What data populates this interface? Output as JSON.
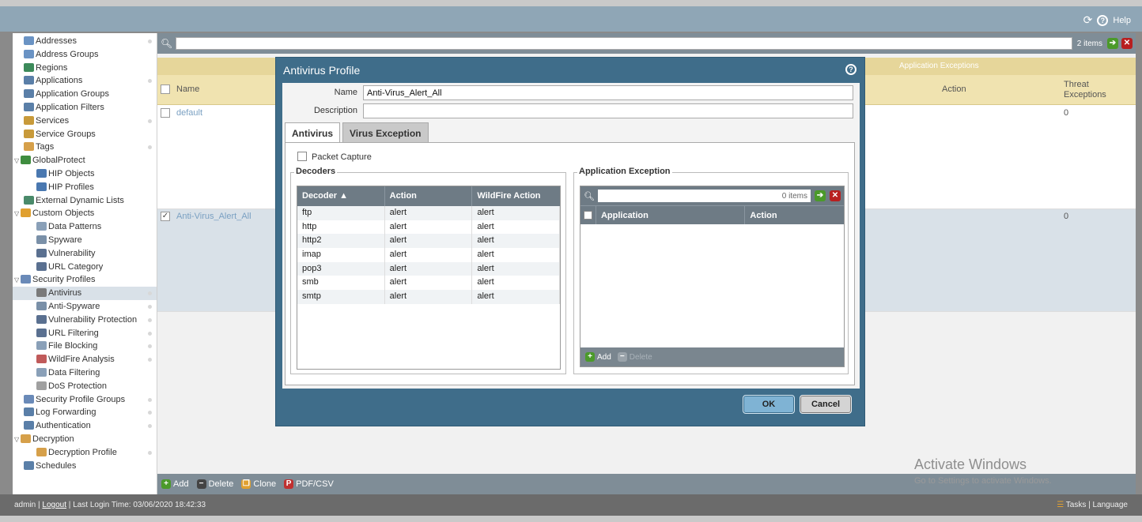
{
  "header": {
    "help_label": "Help"
  },
  "sidebar": {
    "items": [
      {
        "label": "Addresses",
        "level": 1,
        "twisty": "",
        "color": "#6a93c4",
        "dot": true
      },
      {
        "label": "Address Groups",
        "level": 1,
        "twisty": "",
        "color": "#6a93c4",
        "dot": false
      },
      {
        "label": "Regions",
        "level": 1,
        "twisty": "",
        "color": "#3c8a5a",
        "dot": false
      },
      {
        "label": "Applications",
        "level": 1,
        "twisty": "",
        "color": "#5a7fa8",
        "dot": true
      },
      {
        "label": "Application Groups",
        "level": 1,
        "twisty": "",
        "color": "#5a7fa8",
        "dot": false
      },
      {
        "label": "Application Filters",
        "level": 1,
        "twisty": "",
        "color": "#5a7fa8",
        "dot": false
      },
      {
        "label": "Services",
        "level": 1,
        "twisty": "",
        "color": "#c89a3a",
        "dot": true
      },
      {
        "label": "Service Groups",
        "level": 1,
        "twisty": "",
        "color": "#c89a3a",
        "dot": false
      },
      {
        "label": "Tags",
        "level": 1,
        "twisty": "",
        "color": "#d6a04a",
        "dot": true
      },
      {
        "label": "GlobalProtect",
        "level": 0,
        "twisty": "▽",
        "color": "#3f8d3f",
        "dot": false
      },
      {
        "label": "HIP Objects",
        "level": 2,
        "twisty": "",
        "color": "#4a78b0",
        "dot": false
      },
      {
        "label": "HIP Profiles",
        "level": 2,
        "twisty": "",
        "color": "#4a78b0",
        "dot": false
      },
      {
        "label": "External Dynamic Lists",
        "level": 1,
        "twisty": "",
        "color": "#4a8a6a",
        "dot": false
      },
      {
        "label": "Custom Objects",
        "level": 0,
        "twisty": "▽",
        "color": "#e0a030",
        "dot": false
      },
      {
        "label": "Data Patterns",
        "level": 2,
        "twisty": "",
        "color": "#8aa0b8",
        "dot": false
      },
      {
        "label": "Spyware",
        "level": 2,
        "twisty": "",
        "color": "#7a90a8",
        "dot": false
      },
      {
        "label": "Vulnerability",
        "level": 2,
        "twisty": "",
        "color": "#5a7090",
        "dot": false
      },
      {
        "label": "URL Category",
        "level": 2,
        "twisty": "",
        "color": "#5a7090",
        "dot": false
      },
      {
        "label": "Security Profiles",
        "level": 0,
        "twisty": "▽",
        "color": "#6a8ab8",
        "dot": false
      },
      {
        "label": "Antivirus",
        "level": 2,
        "twisty": "",
        "color": "#7a7a7a",
        "dot": true,
        "selected": true
      },
      {
        "label": "Anti-Spyware",
        "level": 2,
        "twisty": "",
        "color": "#7a90a8",
        "dot": true
      },
      {
        "label": "Vulnerability Protection",
        "level": 2,
        "twisty": "",
        "color": "#5a7090",
        "dot": true
      },
      {
        "label": "URL Filtering",
        "level": 2,
        "twisty": "",
        "color": "#5a7090",
        "dot": true
      },
      {
        "label": "File Blocking",
        "level": 2,
        "twisty": "",
        "color": "#8aa0b8",
        "dot": true
      },
      {
        "label": "WildFire Analysis",
        "level": 2,
        "twisty": "",
        "color": "#c05a5a",
        "dot": true
      },
      {
        "label": "Data Filtering",
        "level": 2,
        "twisty": "",
        "color": "#8aa0b8",
        "dot": false
      },
      {
        "label": "DoS Protection",
        "level": 2,
        "twisty": "",
        "color": "#a0a0a0",
        "dot": false
      },
      {
        "label": "Security Profile Groups",
        "level": 1,
        "twisty": "",
        "color": "#6a8ab8",
        "dot": true
      },
      {
        "label": "Log Forwarding",
        "level": 1,
        "twisty": "",
        "color": "#5a7fa8",
        "dot": true
      },
      {
        "label": "Authentication",
        "level": 1,
        "twisty": "",
        "color": "#5a7fa8",
        "dot": true
      },
      {
        "label": "Decryption",
        "level": 0,
        "twisty": "▽",
        "color": "#d6a04a",
        "dot": false
      },
      {
        "label": "Decryption Profile",
        "level": 2,
        "twisty": "",
        "color": "#d6a04a",
        "dot": true
      },
      {
        "label": "Schedules",
        "level": 1,
        "twisty": "",
        "color": "#5a7fa8",
        "dot": false
      }
    ]
  },
  "main": {
    "items_count": "2 items",
    "group_header": "Application Exceptions",
    "col_name": "Name",
    "col_action": "Action",
    "col_threat": "Threat Exceptions",
    "rows": [
      {
        "name": "default",
        "threat": "0",
        "checked": false
      },
      {
        "name": "Anti-Virus_Alert_All",
        "threat": "0",
        "checked": true
      }
    ],
    "bottom": {
      "add": "Add",
      "delete": "Delete",
      "clone": "Clone",
      "pdf": "PDF/CSV"
    }
  },
  "modal": {
    "title": "Antivirus Profile",
    "name_label": "Name",
    "name_value": "Anti-Virus_Alert_All",
    "description_label": "Description",
    "description_value": "",
    "tabs": [
      "Antivirus",
      "Virus Exception"
    ],
    "packet_capture_label": "Packet Capture",
    "decoders_legend": "Decoders",
    "decoder_headers": [
      "Decoder ▲",
      "Action",
      "WildFire Action"
    ],
    "decoders": [
      {
        "decoder": "ftp",
        "action": "alert",
        "wildfire": "alert"
      },
      {
        "decoder": "http",
        "action": "alert",
        "wildfire": "alert"
      },
      {
        "decoder": "http2",
        "action": "alert",
        "wildfire": "alert"
      },
      {
        "decoder": "imap",
        "action": "alert",
        "wildfire": "alert"
      },
      {
        "decoder": "pop3",
        "action": "alert",
        "wildfire": "alert"
      },
      {
        "decoder": "smb",
        "action": "alert",
        "wildfire": "alert"
      },
      {
        "decoder": "smtp",
        "action": "alert",
        "wildfire": "alert"
      }
    ],
    "app_exception_legend": "Application Exception",
    "app_items_count": "0 items",
    "app_headers": [
      "Application",
      "Action"
    ],
    "app_add": "Add",
    "app_delete": "Delete",
    "ok_label": "OK",
    "cancel_label": "Cancel"
  },
  "status": {
    "user": "admin",
    "logout": "Logout",
    "last_login": "Last Login Time: 03/06/2020 18:42:33",
    "tasks": "Tasks",
    "language": "Language"
  },
  "watermark": {
    "title": "Activate Windows",
    "subtitle": "Go to Settings to activate Windows."
  }
}
